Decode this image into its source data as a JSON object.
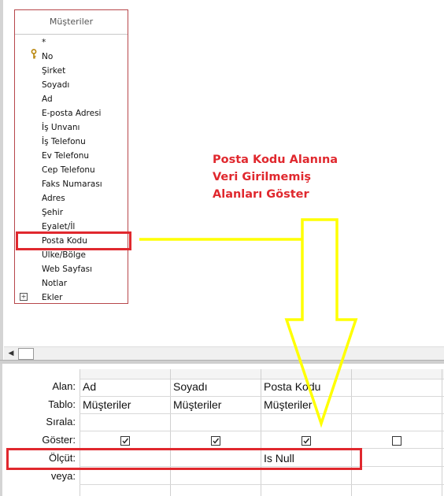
{
  "table": {
    "title": "Müşteriler",
    "fields": [
      "*",
      "No",
      "Şirket",
      "Soyadı",
      "Ad",
      "E-posta Adresi",
      "İş Unvanı",
      "İş Telefonu",
      "Ev Telefonu",
      "Cep Telefonu",
      "Faks Numarası",
      "Adres",
      "Şehir",
      "Eyalet/İl",
      "Posta Kodu",
      "Ülke/Bölge",
      "Web Sayfası",
      "Notlar",
      "Ekler"
    ]
  },
  "annotation": {
    "line1": "Posta Kodu Alanına",
    "line2": "Veri Girilmemiş",
    "line3": "Alanları Göster",
    "color": "#e0282e",
    "arrow_color": "#ffff00"
  },
  "grid": {
    "row_labels": [
      "Alan:",
      "Tablo:",
      "Sırala:",
      "Göster:",
      "Ölçüt:",
      "veya:"
    ],
    "columns": [
      {
        "field": "Ad",
        "table": "Müşteriler",
        "show": true,
        "criteria": ""
      },
      {
        "field": "Soyadı",
        "table": "Müşteriler",
        "show": true,
        "criteria": ""
      },
      {
        "field": "Posta Kodu",
        "table": "Müşteriler",
        "show": true,
        "criteria": "Is Null"
      },
      {
        "field": "",
        "table": "",
        "show": false,
        "criteria": ""
      }
    ]
  },
  "icons": {
    "key": "key-icon",
    "expand": "plus-icon",
    "check": "checkmark-icon",
    "scroll_left": "scroll-left-arrow-icon"
  }
}
